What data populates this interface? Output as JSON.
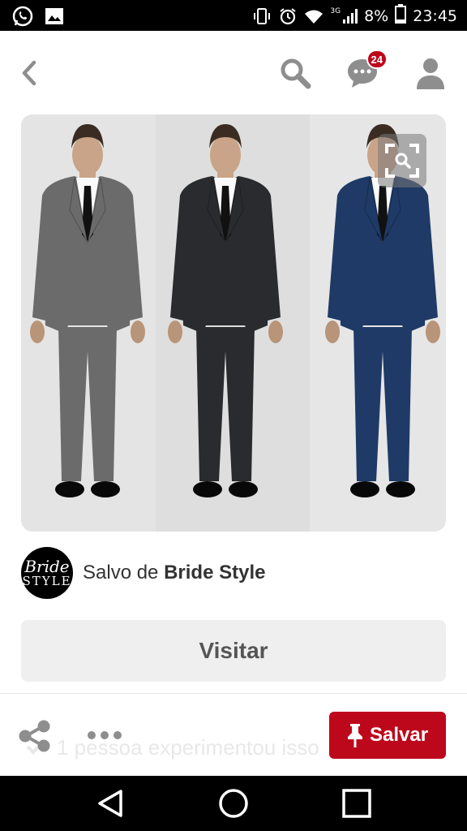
{
  "statusbar": {
    "battery": "8%",
    "time": "23:45",
    "network": "3G",
    "icons": [
      "whatsapp-icon",
      "gallery-icon",
      "vibrate-icon",
      "alarm-icon",
      "wifi-icon",
      "signal-icon",
      "battery-icon"
    ]
  },
  "header": {
    "back_icon": "chevron-left-icon",
    "search_icon": "search-icon",
    "messages_icon": "chat-bubble-icon",
    "messages_badge": "24",
    "profile_icon": "person-icon"
  },
  "pin": {
    "image_description_icon": "visual-search-icon",
    "suit_colors": [
      "#6b6b6b",
      "#2a2b2e",
      "#1f3a66"
    ]
  },
  "source": {
    "avatar_line1": "Bride",
    "avatar_line2": "STYLE",
    "prefix": "Salvo de ",
    "name": "Bride Style"
  },
  "actions": {
    "visit_label": "Visitar",
    "ghost_text": "1 pessoa experimentou isso",
    "save_label": "Salvar",
    "share_icon": "share-icon",
    "more_icon": "more-dots-icon",
    "pin_icon": "pushpin-icon"
  },
  "colors": {
    "accent": "#bd081c",
    "icon_gray": "#8e8e8e"
  },
  "navbar": {
    "back": "nav-back-icon",
    "home": "nav-home-icon",
    "recents": "nav-recents-icon"
  }
}
